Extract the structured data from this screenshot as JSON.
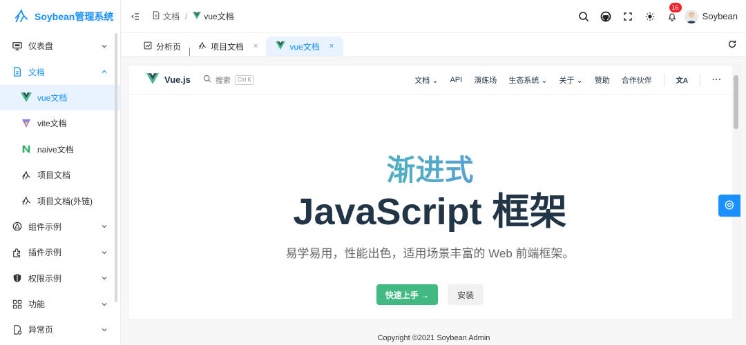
{
  "app": {
    "title": "Soybean管理系统"
  },
  "sidebar": {
    "items": [
      {
        "label": "仪表盘",
        "icon": "dashboard-icon",
        "expandable": true
      },
      {
        "label": "文档",
        "icon": "document-icon",
        "expandable": true,
        "expanded": true
      },
      {
        "label": "vue文档",
        "icon": "vue-logo-icon"
      },
      {
        "label": "vite文档",
        "icon": "vite-logo-icon"
      },
      {
        "label": "naive文档",
        "icon": "naive-logo-icon"
      },
      {
        "label": "项目文档",
        "icon": "project-logo-icon"
      },
      {
        "label": "项目文档(外链)",
        "icon": "project-logo-icon"
      },
      {
        "label": "组件示例",
        "icon": "components-icon",
        "expandable": true
      },
      {
        "label": "插件示例",
        "icon": "plugin-icon",
        "expandable": true
      },
      {
        "label": "权限示例",
        "icon": "shield-icon",
        "expandable": true
      },
      {
        "label": "功能",
        "icon": "grid-icon",
        "expandable": true
      },
      {
        "label": "异常页",
        "icon": "exception-icon",
        "expandable": true
      }
    ]
  },
  "header": {
    "breadcrumb": [
      {
        "label": "文档",
        "icon": "document-icon"
      },
      {
        "label": "vue文档",
        "icon": "vue-logo-icon"
      }
    ],
    "notifications_count": "16",
    "username": "Soybean"
  },
  "tabs": [
    {
      "label": "分析页",
      "icon": "analysis-icon",
      "closable": false
    },
    {
      "label": "项目文档",
      "icon": "project-logo-icon",
      "closable": true,
      "close": "×"
    },
    {
      "label": "vue文档",
      "icon": "vue-logo-icon",
      "closable": true,
      "close": "×",
      "active": true
    }
  ],
  "vue_site": {
    "brand": "Vue.js",
    "search_label": "搜索",
    "search_shortcut": "Ctrl K",
    "nav": [
      "文档 ⌄",
      "API",
      "演练场",
      "生态系统 ⌄",
      "关于 ⌄",
      "赞助",
      "合作伙伴"
    ],
    "translate_icon": "文A",
    "more": "···",
    "hero_line1": "渐进式",
    "hero_line2": "JavaScript 框架",
    "tagline": "易学易用，性能出色，适用场景丰富的 Web 前端框架。",
    "primary_cta": "快速上手 →",
    "secondary_cta": "安装"
  },
  "footer": {
    "copyright": "Copyright ©2021 Soybean Admin"
  },
  "colors": {
    "accent": "#1890ff",
    "vue_green": "#42b883",
    "badge": "#f5222d"
  }
}
